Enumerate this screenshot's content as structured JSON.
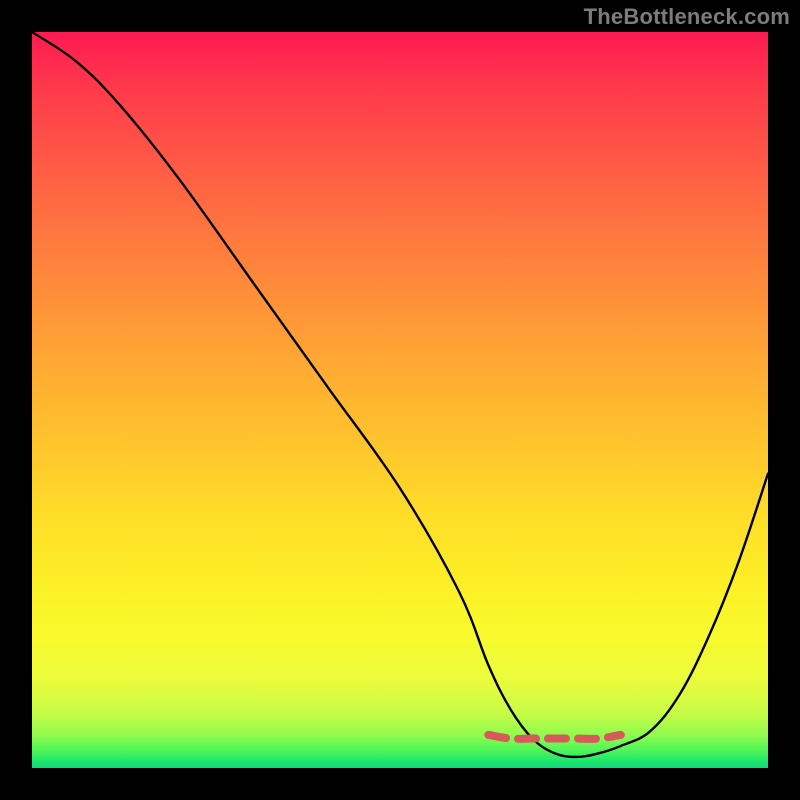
{
  "watermark": "TheBottleneck.com",
  "chart_data": {
    "type": "line",
    "title": "",
    "xlabel": "",
    "ylabel": "",
    "xlim": [
      0,
      100
    ],
    "ylim": [
      0,
      100
    ],
    "series": [
      {
        "name": "bottleneck-curve",
        "x": [
          0,
          6,
          12,
          20,
          30,
          40,
          50,
          58,
          62,
          65,
          68,
          71,
          74,
          77,
          80,
          84,
          88,
          92,
          96,
          100
        ],
        "values": [
          100,
          96,
          90,
          80,
          66,
          52,
          38,
          24,
          14,
          8,
          4,
          2,
          1.5,
          2,
          3,
          5,
          10,
          18,
          28,
          40
        ]
      },
      {
        "name": "optimal-zone-marker",
        "x": [
          62,
          65,
          68,
          71,
          74,
          77,
          80
        ],
        "values": [
          4.5,
          4,
          4,
          4,
          4,
          4,
          4.5
        ]
      }
    ],
    "gradient_stops": [
      {
        "pos": 0,
        "color": "#ff1a52"
      },
      {
        "pos": 8,
        "color": "#ff3b4b"
      },
      {
        "pos": 17,
        "color": "#ff5745"
      },
      {
        "pos": 27,
        "color": "#ff7640"
      },
      {
        "pos": 37,
        "color": "#ff9238"
      },
      {
        "pos": 47,
        "color": "#ffae32"
      },
      {
        "pos": 57,
        "color": "#ffc72c"
      },
      {
        "pos": 66,
        "color": "#ffde28"
      },
      {
        "pos": 75,
        "color": "#fcef26"
      },
      {
        "pos": 82,
        "color": "#f8fa2c"
      },
      {
        "pos": 88,
        "color": "#ebfb3c"
      },
      {
        "pos": 92.5,
        "color": "#c7fc46"
      },
      {
        "pos": 95.5,
        "color": "#91fb4e"
      },
      {
        "pos": 97.5,
        "color": "#52f658"
      },
      {
        "pos": 99,
        "color": "#20e86a"
      },
      {
        "pos": 100,
        "color": "#09d87d"
      }
    ]
  }
}
